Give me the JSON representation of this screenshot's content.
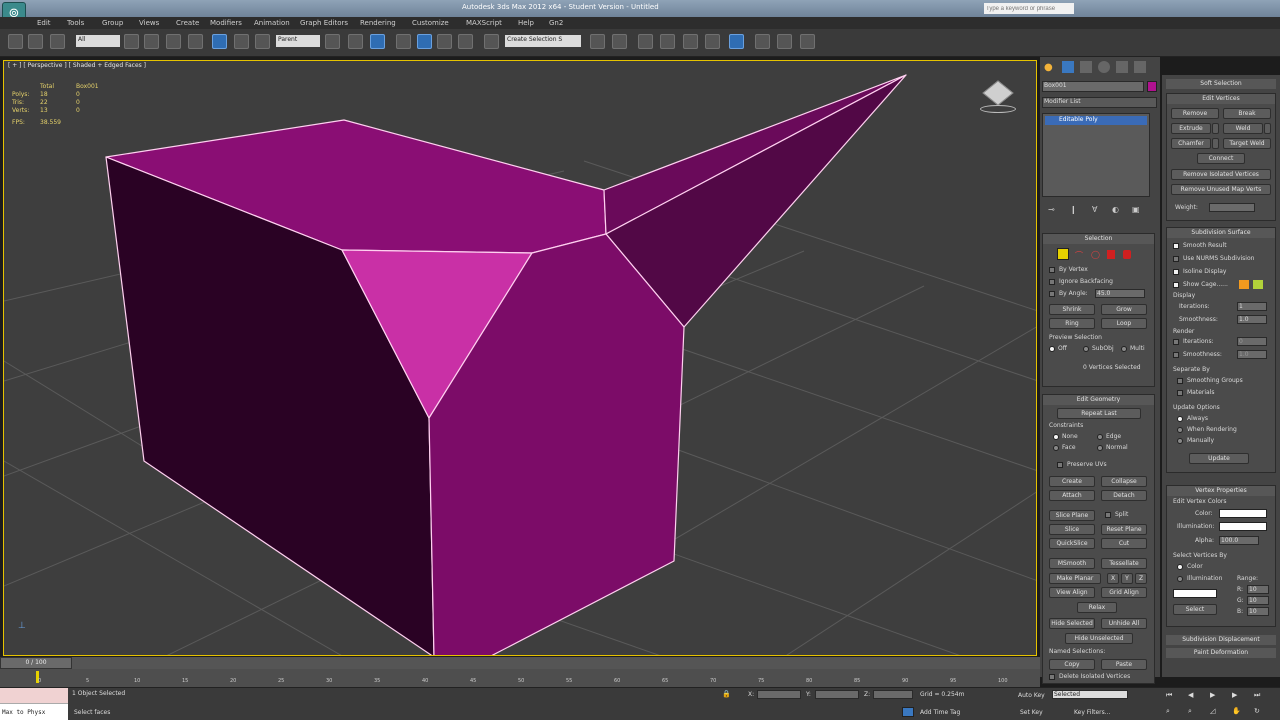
{
  "titlebar": {
    "title": "Autodesk 3ds Max 2012 x64 - Student Version - Untitled"
  },
  "search": {
    "placeholder": "Type a keyword or phrase"
  },
  "menu": {
    "items": [
      "Edit",
      "Tools",
      "Group",
      "Views",
      "Create",
      "Modifiers",
      "Animation",
      "Graph Editors",
      "Rendering",
      "Customize",
      "MAXScript",
      "Help",
      "Gn2"
    ]
  },
  "toolbar": {
    "selection_filter": "All",
    "ref_coord": "Parent",
    "named_selection": "Create Selection S"
  },
  "viewport": {
    "label": "[ + ] [ Perspective ] [ Shaded + Edged Faces ]",
    "stats": {
      "header_total": "Total",
      "header_obj": "Box001",
      "rows": [
        {
          "k": "Polys:",
          "a": "18",
          "b": "0"
        },
        {
          "k": "Tris:",
          "a": "22",
          "b": "0"
        },
        {
          "k": "Verts:",
          "a": "13",
          "b": "0"
        }
      ],
      "fps_label": "FPS:",
      "fps": "38.559"
    }
  },
  "command_panel": {
    "object_name": "Box001",
    "modifier_list": "Modifier List",
    "stack_item": "Editable Poly",
    "selection": {
      "title": "Selection",
      "by_vertex": "By Vertex",
      "ignore_backfacing": "Ignore Backfacing",
      "by_angle": "By Angle:",
      "angle": "45.0",
      "shrink": "Shrink",
      "grow": "Grow",
      "ring": "Ring",
      "loop": "Loop",
      "preview_selection": "Preview Selection",
      "off": "Off",
      "subobj": "SubObj",
      "multi": "Multi",
      "status": "0 Vertices Selected"
    },
    "edit_geometry": {
      "title": "Edit Geometry",
      "repeat_last": "Repeat Last",
      "constraints": "Constraints",
      "none": "None",
      "edge": "Edge",
      "face": "Face",
      "normal": "Normal",
      "preserve_uvs": "Preserve UVs",
      "create": "Create",
      "collapse": "Collapse",
      "attach": "Attach",
      "detach": "Detach",
      "slice_plane": "Slice Plane",
      "split": "Split",
      "slice": "Slice",
      "reset_plane": "Reset Plane",
      "quickslice": "QuickSlice",
      "cut": "Cut",
      "msmooth": "MSmooth",
      "tessellate": "Tessellate",
      "make_planar": "Make Planar",
      "x": "X",
      "y": "Y",
      "z": "Z",
      "view_align": "View Align",
      "grid_align": "Grid Align",
      "relax": "Relax",
      "hide_selected": "Hide Selected",
      "unhide_all": "Unhide All",
      "hide_unselected": "Hide Unselected",
      "named_selections": "Named Selections:",
      "copy": "Copy",
      "paste": "Paste",
      "delete_isolated": "Delete Isolated Vertices"
    }
  },
  "right_panel": {
    "soft_selection": "Soft Selection",
    "edit_vertices": {
      "title": "Edit Vertices",
      "remove": "Remove",
      "break": "Break",
      "extrude": "Extrude",
      "weld": "Weld",
      "chamfer": "Chamfer",
      "target_weld": "Target Weld",
      "connect": "Connect",
      "remove_isolated": "Remove Isolated Vertices",
      "remove_unused": "Remove Unused Map Verts",
      "weight": "Weight:"
    },
    "subdivision_surface": {
      "title": "Subdivision Surface",
      "smooth_result": "Smooth Result",
      "use_nurms": "Use NURMS Subdivision",
      "isoline_display": "Isoline Display",
      "show_cage": "Show Cage......",
      "display": "Display",
      "iterations": "Iterations:",
      "iterations_val": "1",
      "smoothness": "Smoothness:",
      "smoothness_val": "1.0",
      "render": "Render",
      "r_iterations_val": "0",
      "r_smoothness_val": "1.0",
      "separate_by": "Separate By",
      "smoothing_groups": "Smoothing Groups",
      "materials": "Materials",
      "update_options": "Update Options",
      "always": "Always",
      "when_rendering": "When Rendering",
      "manually": "Manually",
      "update": "Update"
    },
    "vertex_properties": {
      "title": "Vertex Properties",
      "edit_vertex_colors": "Edit Vertex Colors",
      "color": "Color:",
      "illumination": "Illumination:",
      "alpha": "Alpha:",
      "alpha_val": "100.0",
      "select_vertices_by": "Select Vertices By",
      "color_opt": "Color",
      "illum_opt": "Illumination",
      "range": "Range:",
      "r": "R:",
      "g": "G:",
      "b": "B:",
      "rv": "10",
      "gv": "10",
      "bv": "10",
      "select": "Select"
    },
    "subdivision_displacement": "Subdivision Displacement",
    "paint_deformation": "Paint Deformation"
  },
  "timeline": {
    "frame": "0 / 100",
    "ticks": [
      "0",
      "5",
      "10",
      "15",
      "20",
      "25",
      "30",
      "35",
      "40",
      "45",
      "50",
      "55",
      "60",
      "65",
      "70",
      "75",
      "80",
      "85",
      "90",
      "95",
      "100"
    ]
  },
  "status": {
    "maxscript": "Max to Physx",
    "object_selected": "1 Object Selected",
    "prompt": "Select faces",
    "x_label": "X:",
    "y_label": "Y:",
    "z_label": "Z:",
    "grid": "Grid = 0.254m",
    "add_time_tag": "Add Time Tag",
    "auto_key": "Auto Key",
    "set_key": "Set Key",
    "key_mode": "Selected",
    "key_filters": "Key Filters..."
  },
  "colors": {
    "object": "#8a0e74",
    "face_selected": "#c930a6",
    "wire": "#ffd0f0",
    "viewport_bg": "#3e3e3e",
    "active_border": "#e6c300"
  }
}
